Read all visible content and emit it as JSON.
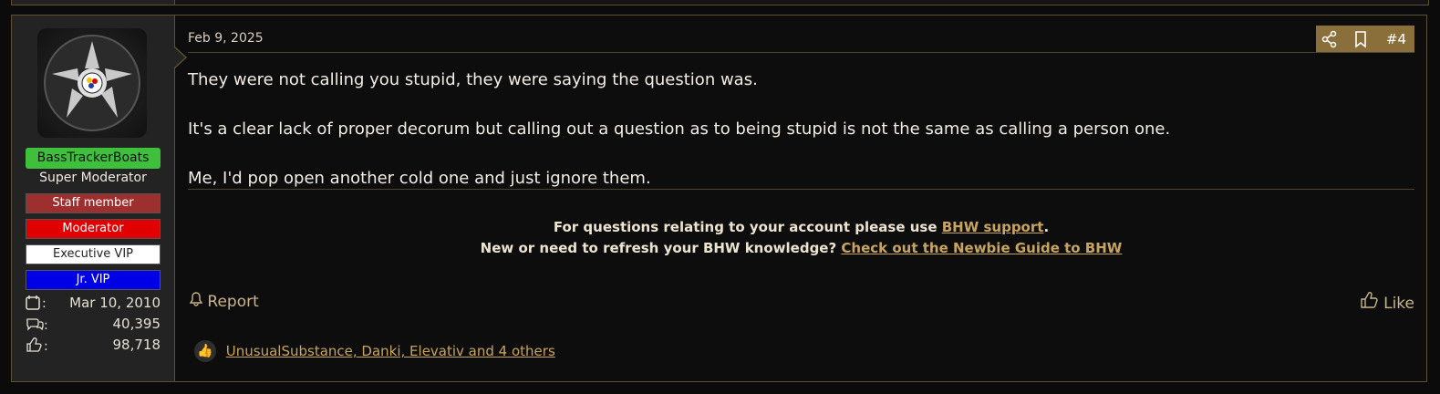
{
  "post": {
    "date": "Feb 9, 2025",
    "number": "#4",
    "message": [
      "They were not calling you stupid, they were saying the question was.",
      "It's a clear lack of proper decorum but calling out a question as to being stupid is not the same as calling a person one.",
      "Me, I'd pop open another cold one and just ignore them."
    ],
    "signature": {
      "line1_prefix": "For questions relating to your account please use ",
      "line1_link": "BHW support",
      "line1_suffix": ".",
      "line2_prefix": "New or need to refresh your BHW knowledge? ",
      "line2_link": "Check out the Newbie Guide to BHW"
    },
    "report_label": "Report",
    "like_label": "Like",
    "reactions_text": "UnusualSubstance, Danki, Elevativ and 4 others"
  },
  "user": {
    "username": "BassTrackerBoats",
    "title": "Super Moderator",
    "banners": {
      "staff": "Staff member",
      "moderator": "Moderator",
      "exec": "Executive VIP",
      "jr": "Jr. VIP"
    },
    "stats": {
      "joined": "Mar 10, 2010",
      "messages": "40,395",
      "reactions": "98,718"
    },
    "username_color": "#3ec03c"
  },
  "icons": {
    "share": "share-icon",
    "bookmark": "bookmark-icon",
    "report": "bell-icon",
    "like": "thumbs-up-icon",
    "calendar": "calendar-icon",
    "messages": "chat-bubbles-icon",
    "reaction_score": "thumbs-up-outline-icon"
  },
  "colors": {
    "accent": "#8b6f3b",
    "link": "#c8a55e",
    "border": "#5e5030"
  }
}
